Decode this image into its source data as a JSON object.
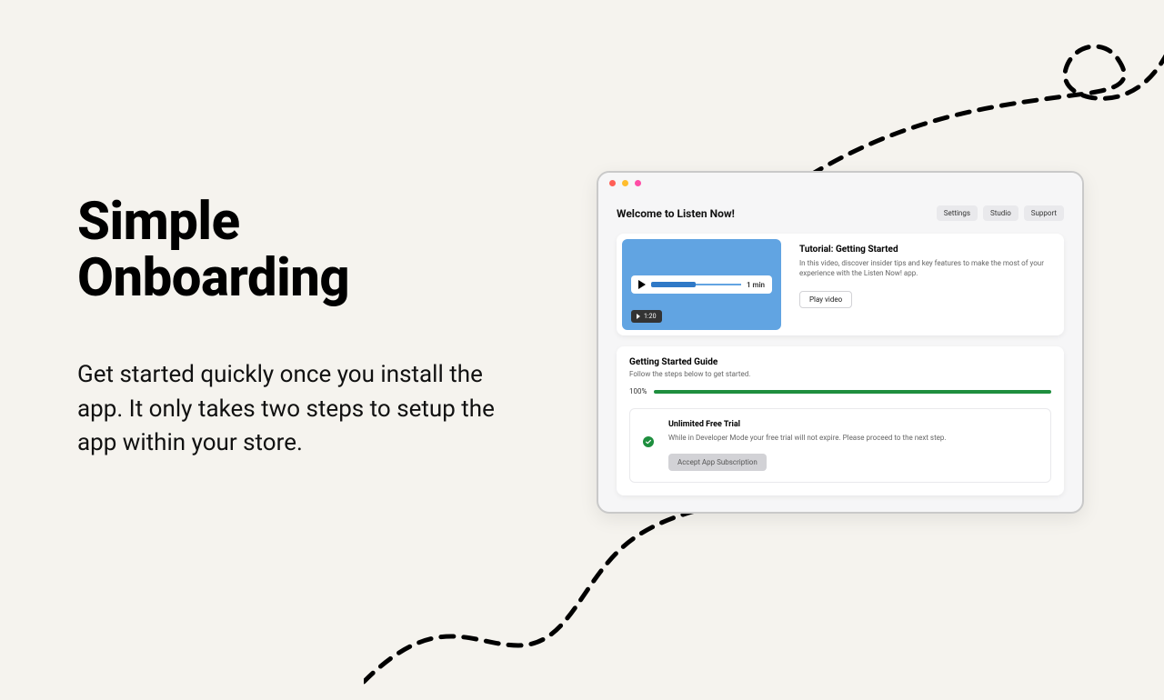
{
  "marketing": {
    "headline_line1": "Simple",
    "headline_line2": "Onboarding",
    "subtext": "Get started quickly once you install the app. It only takes two steps to setup the app within your store."
  },
  "app": {
    "title": "Welcome to Listen Now!",
    "header_buttons": [
      "Settings",
      "Studio",
      "Support"
    ],
    "video": {
      "title": "Tutorial: Getting Started",
      "description": "In this video, discover insider tips and key features to make the most of your experience with the Listen Now! app.",
      "play_button": "Play video",
      "badge_time": "1:20",
      "strip_time": "1 min"
    },
    "guide": {
      "title": "Getting Started Guide",
      "subtitle": "Follow the steps below to get started.",
      "progress_pct": "100%",
      "step": {
        "title": "Unlimited Free Trial",
        "description": "While in Developer Mode your free trial will not expire. Please proceed to the next step.",
        "button": "Accept App Subscription"
      }
    }
  }
}
